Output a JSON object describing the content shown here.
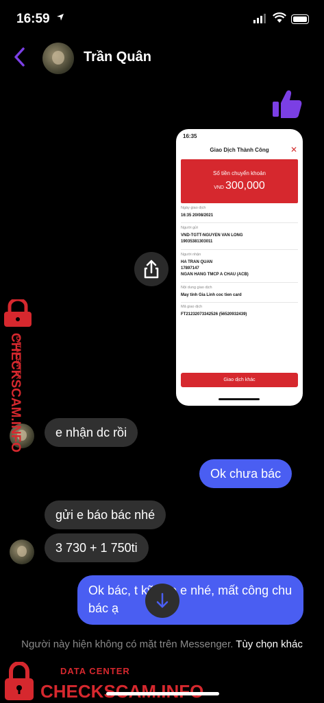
{
  "status": {
    "time": "16:59"
  },
  "header": {
    "name": "Trần Quân"
  },
  "receipt": {
    "status_time": "16:35",
    "title": "Giao Dịch Thành Công",
    "amount_label": "Số tiền chuyển khoản",
    "currency": "VND",
    "amount": "300,000",
    "rows": [
      {
        "label": "Ngày giao dịch",
        "value": "16:35 20/08/2021"
      },
      {
        "label": "Người gửi",
        "value": "VND-TGTT-NGUYEN VAN LONG\n19035381303011"
      },
      {
        "label": "Người nhận",
        "value": "HA TRAN QUAN\n17897147\nNGAN HANG TMCP A CHAU (ACB)"
      },
      {
        "label": "Nội dung giao dịch",
        "value": "May tinh Gia Linh coc tien card"
      },
      {
        "label": "Mã giao dịch",
        "value": "FT21232073342526 (56520932439)"
      }
    ],
    "button": "Giao dịch khác"
  },
  "messages": {
    "m1": "e nhận dc rồi",
    "m2": "Ok chưa bác",
    "m3": "gửi e báo bác nhé",
    "m4": "3 730 + 1 750ti",
    "m5": "Ok bác, t    kỹ cho e nhé, mất công chu     bác ạ"
  },
  "footer": {
    "notice": "Người này hiện không có mặt trên Messenger.",
    "more": "Tùy chọn khác"
  },
  "watermark": {
    "top": "DATA CENTER",
    "site": "CHECKSCAM.INFO",
    "color": "#d6282e"
  },
  "colors": {
    "accent": "#7b3fe4",
    "outgoing": "#4a5ef2",
    "incoming": "#303030"
  }
}
